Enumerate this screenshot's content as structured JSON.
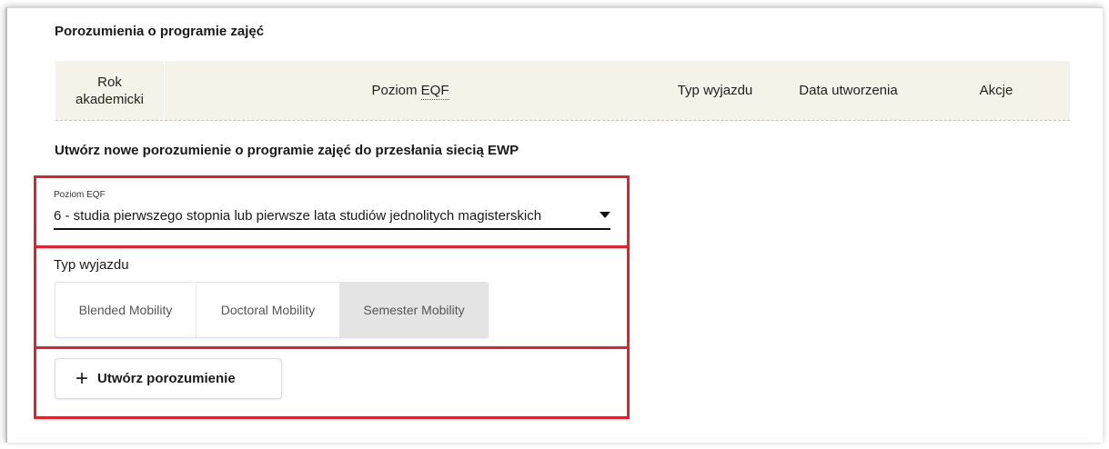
{
  "agreements_title": "Porozumienia o programie zajęć",
  "table": {
    "headers": {
      "year_line1": "Rok",
      "year_line2": "akademicki",
      "eqf_prefix": "Poziom ",
      "eqf_abbr": "EQF",
      "type": "Typ wyjazdu",
      "date": "Data utworzenia",
      "actions": "Akcje"
    },
    "rows": []
  },
  "create_title": "Utwórz nowe porozumienie o programie zajęć do przesłania siecią EWP",
  "eqf_field": {
    "label": "Poziom EQF",
    "selected_value": "6 - studia pierwszego stopnia lub pierwsze lata studiów jednolitych magisterskich"
  },
  "mobility_type": {
    "label": "Typ wyjazdu",
    "options": [
      "Blended Mobility",
      "Doctoral Mobility",
      "Semester Mobility"
    ],
    "selected": "Semester Mobility"
  },
  "create_button": {
    "icon": "plus-icon",
    "label": "Utwórz porozumienie"
  },
  "colors": {
    "highlight_border": "#e4202c",
    "table_header_bg": "#f5f3e9",
    "selected_option_bg": "#e4e4e4"
  }
}
